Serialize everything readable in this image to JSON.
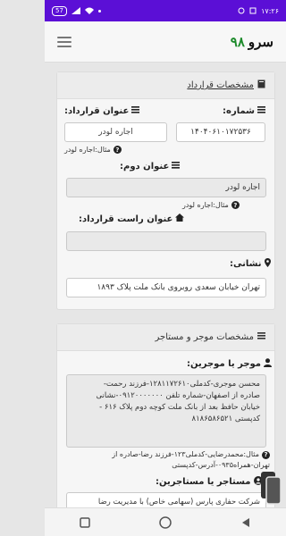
{
  "status_bar": {
    "time": "۱۷:۲۶",
    "battery": "57"
  },
  "header": {
    "brand_word": "سرو",
    "brand_num": "۹۸"
  },
  "contract": {
    "header": "مشخصات قرارداد",
    "number_label": "شماره:",
    "number_value": "۱۴۰۴۰۶۱۰۱۷۲۵۳۶",
    "title_label": "عنوان قرارداد:",
    "title_placeholder": "اجاره لودر",
    "title_hint": "مثال:اجاره لودر",
    "second_label": "عنوان دوم:",
    "second_value": "اجاره لودر",
    "second_hint": "مثال:اجاره لودر",
    "right_label": "عنوان راست قرارداد:",
    "right_value": "",
    "address_label": "نشانی:",
    "address_value": "تهران خیابان سعدی روبروی بانک ملت پلاک ۱۸۹۳"
  },
  "parties": {
    "header": "مشخصات موجر و مستاجر",
    "lessor_label": "موجر یا موجرین:",
    "lessor_lines": [
      "محسن موجری-کدملی۱۲۸۱۱۷۲۶۱۰-فرزند رحمت-",
      "صادره از اصفهان-شماره تلفن ۰۹۱۲۰۰۰۰۰۰۰-نشانی",
      "خیابان حافظ بعد از بانک ملت کوچه دوم پلاک ۶۱۶ -",
      "کدپستی ۸۱۸۶۵۸۶۵۲۱"
    ],
    "lessor_hint_lines": [
      "مثال:محمدرضایی-کدملی۱۲۳-فرزند رضا-صادره از",
      "تهران-همراه۰۹۳۵-آدرس-کدپستی"
    ],
    "lessee_label": "مستاجر یا مستاجرین:",
    "lessee_value": "شرکت حفاری پارس (سهامی خاص) با مدیریت رضا"
  },
  "colors": {
    "status_bar": "#5b0fd6",
    "brand_num": "#1c8a2a"
  },
  "icons": [
    "book-icon",
    "list-icon",
    "home-icon",
    "map-marker-icon",
    "user-icon",
    "question-icon",
    "copy-icon",
    "back-icon",
    "home-nav-icon",
    "recents-icon"
  ]
}
